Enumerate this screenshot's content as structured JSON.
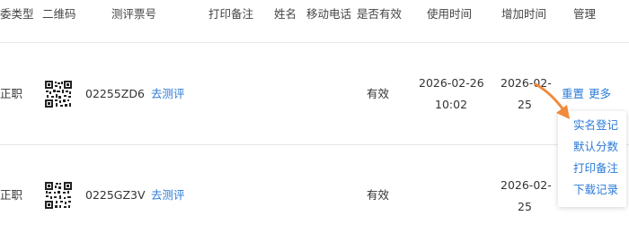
{
  "columns": [
    "委类型",
    "二维码",
    "测评票号",
    "打印备注",
    "姓名",
    "移动电话",
    "是否有效",
    "使用时间",
    "增加时间",
    "管理"
  ],
  "rows": [
    {
      "type": "正职",
      "ticket": "02255ZD6",
      "action": "去测评",
      "print_note": "",
      "name": "",
      "phone": "",
      "valid": "有效",
      "use_time_date": "2026-02-26",
      "use_time_time": "10:02",
      "add_time_date": "2026-02-",
      "add_time_day": "25",
      "manage_reset": "重置",
      "manage_more": "更多"
    },
    {
      "type": "正职",
      "ticket": "0225GZ3V",
      "action": "去测评",
      "print_note": "",
      "name": "",
      "phone": "",
      "valid": "有效",
      "use_time_date": "",
      "use_time_time": "",
      "add_time_date": "2026-02-",
      "add_time_day": "25"
    }
  ],
  "more_menu": [
    "实名登记",
    "默认分数",
    "打印备注",
    "下载记录"
  ],
  "colors": {
    "link": "#2b7bd8",
    "arrow": "#f08a3c",
    "separator": "#e6e6e6"
  }
}
